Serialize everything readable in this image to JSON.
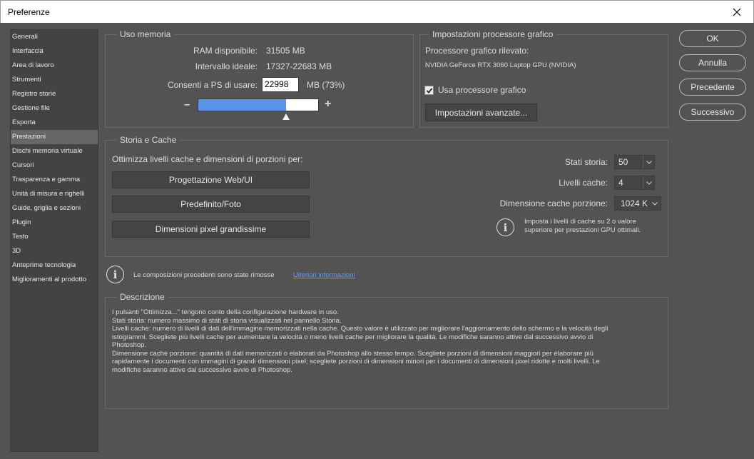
{
  "window": {
    "title": "Preferenze"
  },
  "sidebar": {
    "items": [
      {
        "label": "Generali"
      },
      {
        "label": "Interfaccia"
      },
      {
        "label": "Area di lavoro"
      },
      {
        "label": "Strumenti"
      },
      {
        "label": "Registro storie"
      },
      {
        "label": "Gestione file"
      },
      {
        "label": "Esporta"
      },
      {
        "label": "Prestazioni",
        "active": true
      },
      {
        "label": "Dischi memoria virtuale"
      },
      {
        "label": "Cursori"
      },
      {
        "label": "Trasparenza e gamma"
      },
      {
        "label": "Unità di misura e righelli"
      },
      {
        "label": "Guide, griglia e sezioni"
      },
      {
        "label": "Plugin"
      },
      {
        "label": "Testo"
      },
      {
        "label": "3D"
      },
      {
        "label": "Anteprime tecnologia"
      },
      {
        "label": "Miglioramenti al prodotto"
      }
    ]
  },
  "memory": {
    "legend": "Uso memoria",
    "ram_label": "RAM disponibile:",
    "ram_value": "31505 MB",
    "ideal_label": "Intervallo ideale:",
    "ideal_value": "17327-22683 MB",
    "allow_label": "Consenti a PS di usare:",
    "allow_value": "22998",
    "allow_unit": "MB (73%)",
    "minus": "–",
    "plus": "+",
    "slider_fraction": 0.73
  },
  "gpu": {
    "legend": "Impostazioni processore grafico",
    "detected_label": "Processore grafico rilevato:",
    "detected_value": "NVIDIA GeForce RTX 3060 Laptop GPU (NVIDIA)",
    "use_gpu_label": "Usa processore grafico",
    "use_gpu_checked": true,
    "advanced_button": "Impostazioni avanzate..."
  },
  "cache": {
    "legend": "Storia e Cache",
    "optimize_label": "Ottimizza livelli cache e dimensioni di porzioni per:",
    "btn_web": "Progettazione Web/UI",
    "btn_default": "Predefinito/Foto",
    "btn_huge": "Dimensioni pixel grandissime",
    "history_label": "Stati storia:",
    "history_value": "50",
    "levels_label": "Livelli cache:",
    "levels_value": "4",
    "tile_label": "Dimensione cache porzione:",
    "tile_value": "1024 K",
    "hint_line1": "Imposta i livelli di cache su 2 o valore",
    "hint_line2": "superiore per prestazioni GPU ottimali."
  },
  "notice": {
    "text": "Le composizioni precedenti sono state rimosse",
    "link": "Ulteriori informazioni"
  },
  "description": {
    "legend": "Descrizione",
    "lines": [
      "I pulsanti \"Ottimizza...\" tengono conto della configurazione hardware in uso.",
      "Stati storia: numero massimo di stati di storia visualizzati nel pannello Storia.",
      "Livelli cache: numero di livelli di dati dell'immagine memorizzati nella cache. Questo valore è utilizzato per migliorare l'aggiornamento dello schermo e la velocità degli",
      "istogrammi. Scegliete più livelli cache per aumentare la velocità o meno livelli cache per migliorare la qualità. Le modifiche saranno attive dal successivo avvio di",
      "Photoshop.",
      "Dimensione cache porzione: quantità di dati memorizzati o elaborati da Photoshop allo stesso tempo. Scegliete porzioni di dimensioni maggiori per elaborare più",
      "rapidamente i documenti con immagini di grandi dimensioni pixel; scegliete porzioni di dimensioni minori per i documenti di dimensioni pixel ridotte e molti livelli. Le",
      "modifiche saranno attive dal successivo avvio di Photoshop."
    ]
  },
  "actions": {
    "ok": "OK",
    "cancel": "Annulla",
    "prev": "Precedente",
    "next": "Successivo"
  },
  "icons": {
    "close": "close-icon",
    "check": "checkmark-icon",
    "dropdown": "chevron-down-icon",
    "info": "info-icon"
  }
}
